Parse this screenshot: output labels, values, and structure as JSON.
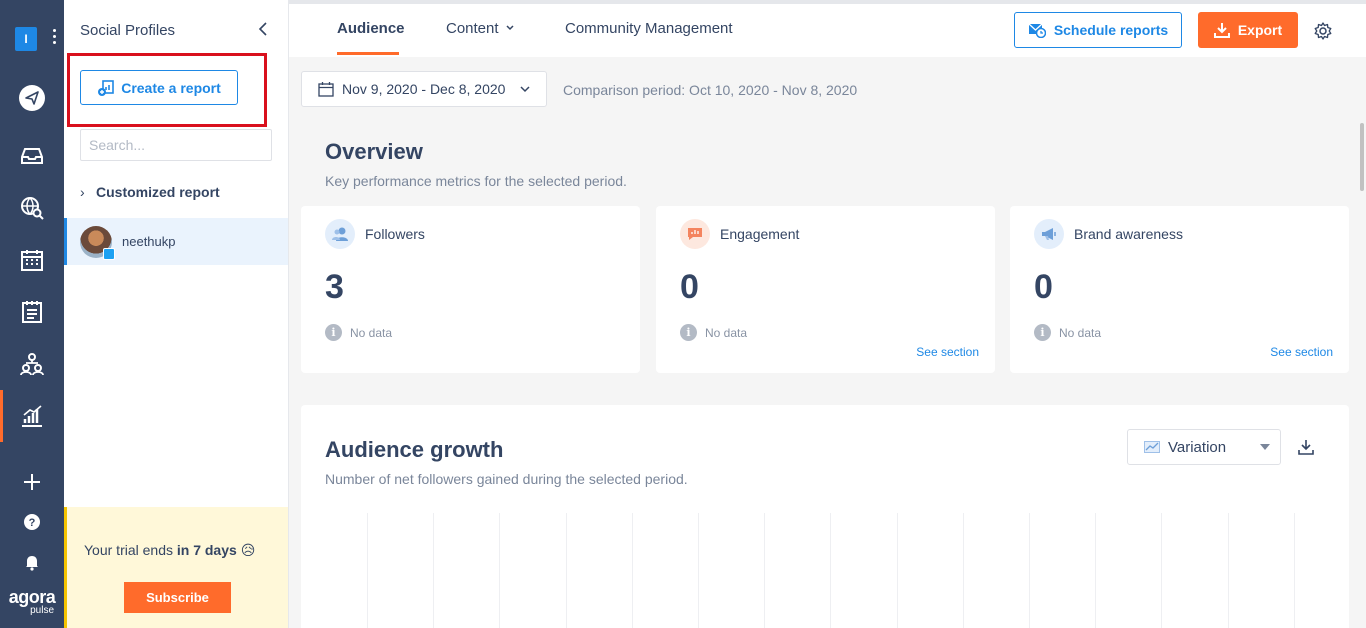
{
  "rail": {
    "workspace_initial": "I",
    "logo_line1": "agora",
    "logo_line2": "pulse",
    "icons": [
      "paper-plane-icon",
      "inbox-icon",
      "globe-search-icon",
      "calendar-icon",
      "notes-icon",
      "users-network-icon",
      "reports-chart-icon",
      "plus-icon",
      "help-icon",
      "bell-icon"
    ]
  },
  "sidebar": {
    "title": "Social Profiles",
    "create_report": "Create a report",
    "search_placeholder": "Search...",
    "customized_report": "Customized report",
    "profile_name": "neethukp",
    "trial_text_prefix": "Your trial ends ",
    "trial_text_bold": "in 7 days",
    "trial_emoji": "😥",
    "subscribe": "Subscribe"
  },
  "topbar": {
    "tabs": [
      "Audience",
      "Content",
      "Community Management"
    ],
    "active_tab": "Audience",
    "schedule_reports": "Schedule reports",
    "export": "Export"
  },
  "main": {
    "date_range": "Nov 9, 2020 - Dec 8, 2020",
    "comparison": "Comparison period: Oct 10, 2020 - Nov 8, 2020",
    "overview_title": "Overview",
    "overview_sub": "Key performance metrics for the selected period.",
    "cards": [
      {
        "label": "Followers",
        "value": "3",
        "note": "No data",
        "link": ""
      },
      {
        "label": "Engagement",
        "value": "0",
        "note": "No data",
        "link": "See section"
      },
      {
        "label": "Brand awareness",
        "value": "0",
        "note": "No data",
        "link": "See section"
      }
    ],
    "growth_title": "Audience growth",
    "growth_sub": "Number of net followers gained during the selected period.",
    "variation_label": "Variation"
  },
  "colors": {
    "rail_bg": "#344563",
    "accent_orange": "#ff6b2b",
    "accent_blue": "#1e88e5",
    "highlight_red": "#d9101d",
    "trial_bg": "#fff8d9"
  }
}
